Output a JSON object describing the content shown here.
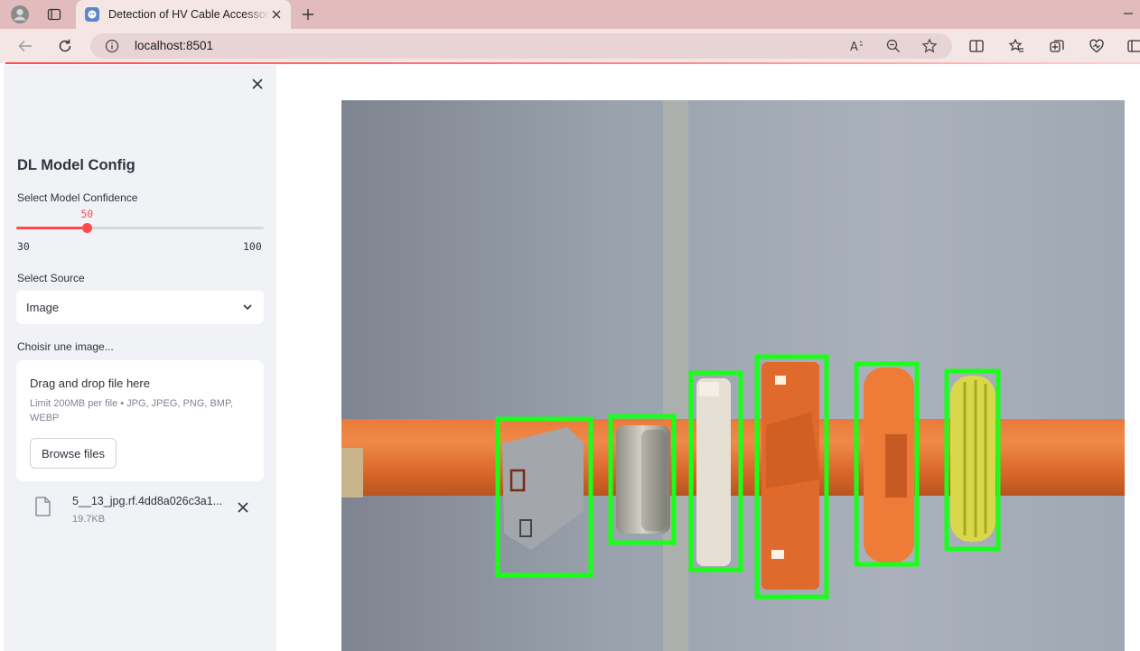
{
  "browser": {
    "tab_title": "Detection of HV Cable Accessories",
    "url": "localhost:8501"
  },
  "sidebar": {
    "title": "DL Model Config",
    "confidence": {
      "label": "Select Model Confidence",
      "value": 50,
      "value_text": "50",
      "min": 30,
      "max": 100,
      "min_text": "30",
      "max_text": "100"
    },
    "source": {
      "label": "Select Source",
      "selected": "Image"
    },
    "uploader": {
      "label": "Choisir une image...",
      "drag_text": "Drag and drop file here",
      "limit_text": "Limit 200MB per file • JPG, JPEG, PNG, BMP, WEBP",
      "browse_label": "Browse files"
    },
    "file": {
      "name": "5__13_jpg.rf.4dd8a026c3a1...",
      "size": "19.7KB"
    }
  },
  "main": {
    "detection_count": 6
  },
  "colors": {
    "accent": "#ff4b4b",
    "detection_box": "#19ff19",
    "sidebar_bg": "#f0f2f6"
  }
}
